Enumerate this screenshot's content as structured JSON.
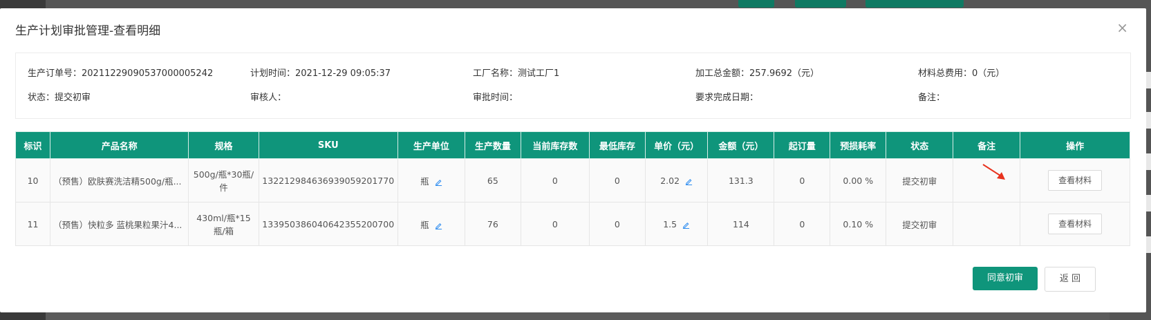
{
  "dialog": {
    "title": "生产计划审批管理-查看明细",
    "close_glyph": "×"
  },
  "info": {
    "order_no": "生产订单号：20211229090537000005242",
    "plan_time": "计划时间：2021-12-29 09:05:37",
    "factory": "工厂名称：测试工厂1",
    "process_amount": "加工总金额：257.9692（元）",
    "material_cost": "材料总费用：0（元）",
    "status": "状态：提交初审",
    "reviewer": "审核人：",
    "review_time": "审批时间：",
    "due_date": "要求完成日期：",
    "remark": "备注："
  },
  "table": {
    "headers": [
      "标识",
      "产品名称",
      "规格",
      "SKU",
      "生产单位",
      "生产数量",
      "当前库存数",
      "最低库存",
      "单价（元）",
      "金额（元）",
      "起订量",
      "预损耗率",
      "状态",
      "备注",
      "操作"
    ],
    "rows": [
      {
        "id": "10",
        "name": "（预售）欧肤赛洗洁精500g/瓶...",
        "spec": "500g/瓶*30瓶/件",
        "sku": "13221298463693905920177​0",
        "unit": "瓶",
        "qty": "65",
        "stock": "0",
        "min_stock": "0",
        "price": "2.02",
        "amount": "131.3",
        "moq": "0",
        "loss_rate": "0.00 %",
        "status": "提交初审",
        "remark": "",
        "action": "查看材料"
      },
      {
        "id": "11",
        "name": "（预售）快粒多 蓝桃果粒果汁4...",
        "spec": "430ml/瓶*15瓶/箱",
        "sku": "1339503860406423552​00700",
        "unit": "瓶",
        "qty": "76",
        "stock": "0",
        "min_stock": "0",
        "price": "1.5",
        "amount": "114",
        "moq": "0",
        "loss_rate": "0.10 %",
        "status": "提交初审",
        "remark": "",
        "action": "查看材料"
      }
    ]
  },
  "footer": {
    "approve_label": "同意初审",
    "back_label": "返 回"
  },
  "colors": {
    "accent": "#0f957b",
    "arrow": "#e8321e",
    "edit_icon": "#2d8cf0"
  }
}
